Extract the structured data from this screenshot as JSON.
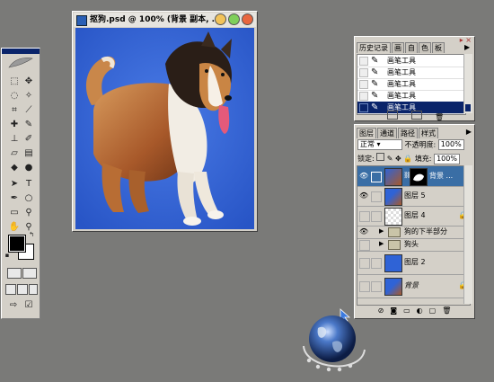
{
  "document": {
    "title": "抠狗.psd @ 100% (背景 副本, ..."
  },
  "history": {
    "tabs": [
      "历史记录",
      "画",
      "自",
      "色",
      "板"
    ],
    "items": [
      {
        "label": "画笔工具",
        "selected": false
      },
      {
        "label": "画笔工具",
        "selected": false
      },
      {
        "label": "画笔工具",
        "selected": false
      },
      {
        "label": "画笔工具",
        "selected": false
      },
      {
        "label": "画笔工具",
        "selected": true
      }
    ]
  },
  "layers": {
    "tabs": [
      "图层",
      "通道",
      "路径",
      "样式"
    ],
    "blend_mode": "正常",
    "opacity_label": "不透明度:",
    "opacity_value": "100%",
    "lock_label": "锁定:",
    "fill_label": "填充:",
    "fill_value": "100%",
    "items": [
      {
        "name": "背景 ...",
        "selected": true,
        "eye": true,
        "type": "image-mask"
      },
      {
        "name": "图层 5",
        "selected": false,
        "eye": true,
        "type": "image"
      },
      {
        "name": "图层 4",
        "selected": false,
        "eye": false,
        "type": "transparent",
        "locked": true
      },
      {
        "name": "狗的下半部分",
        "selected": false,
        "eye": true,
        "type": "folder"
      },
      {
        "name": "狗头",
        "selected": false,
        "eye": false,
        "type": "folder"
      },
      {
        "name": "图层 2",
        "selected": false,
        "eye": false,
        "type": "blue"
      },
      {
        "name": "背景",
        "selected": false,
        "eye": false,
        "type": "image",
        "locked": true
      }
    ]
  },
  "colors": {
    "foreground": "#000000",
    "background": "#ffffff",
    "canvas_blue": "#2f63d6",
    "selection": "#0a246a"
  }
}
